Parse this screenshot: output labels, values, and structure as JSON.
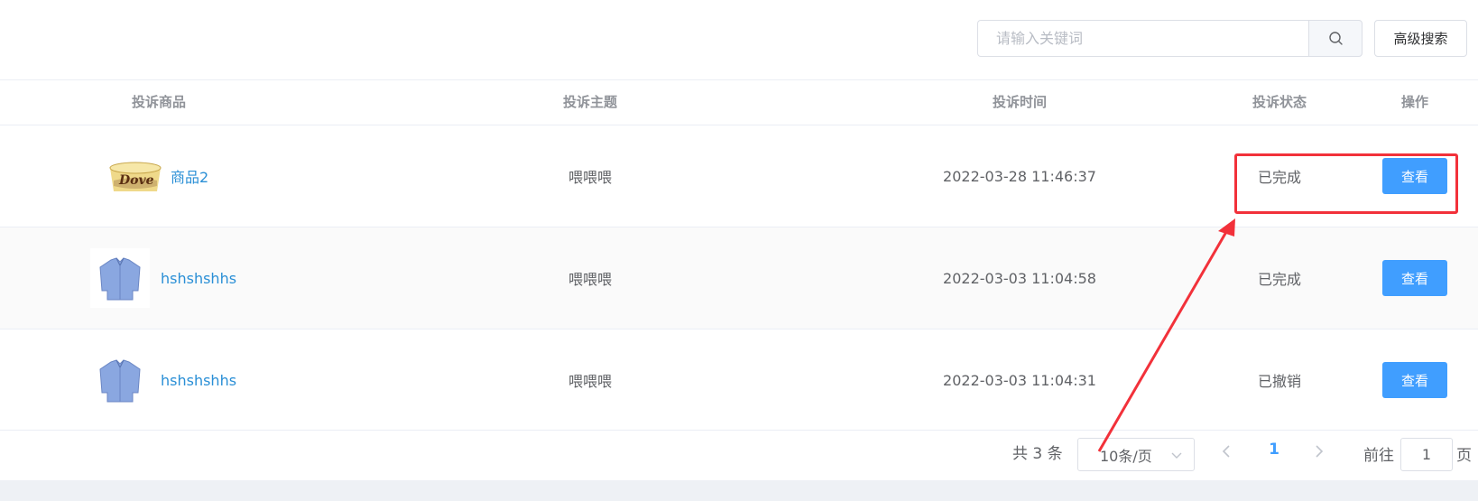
{
  "toolbar": {
    "search_placeholder": "请输入关键词",
    "search_value": "",
    "search_icon": "search-icon",
    "advanced_search_label": "高级搜索"
  },
  "table": {
    "headers": [
      "投诉商品",
      "投诉主题",
      "投诉时间",
      "投诉状态",
      "操作"
    ],
    "rows": [
      {
        "product_name": "商品2",
        "thumbnail": "dove-chocolate-thumbnail",
        "subject": "喂喂喂",
        "time": "2022-03-28 11:46:37",
        "status": "已完成",
        "action": "查看"
      },
      {
        "product_name": "hshshshhs",
        "thumbnail": "blue-shirt-thumbnail",
        "subject": "喂喂喂",
        "time": "2022-03-03 11:04:58",
        "status": "已完成",
        "action": "查看"
      },
      {
        "product_name": "hshshshhs",
        "thumbnail": "blue-shirt-thumbnail",
        "subject": "喂喂喂",
        "time": "2022-03-03 11:04:31",
        "status": "已撤销",
        "action": "查看"
      }
    ]
  },
  "pagination": {
    "total_label": "共 3 条",
    "page_size": "10条/页",
    "current_page": "1",
    "goto_label": "前往",
    "goto_value": "1",
    "page_suffix": "页"
  },
  "colors": {
    "primary": "#409eff",
    "link": "#2a8fd6",
    "annotation": "#f2313a"
  }
}
